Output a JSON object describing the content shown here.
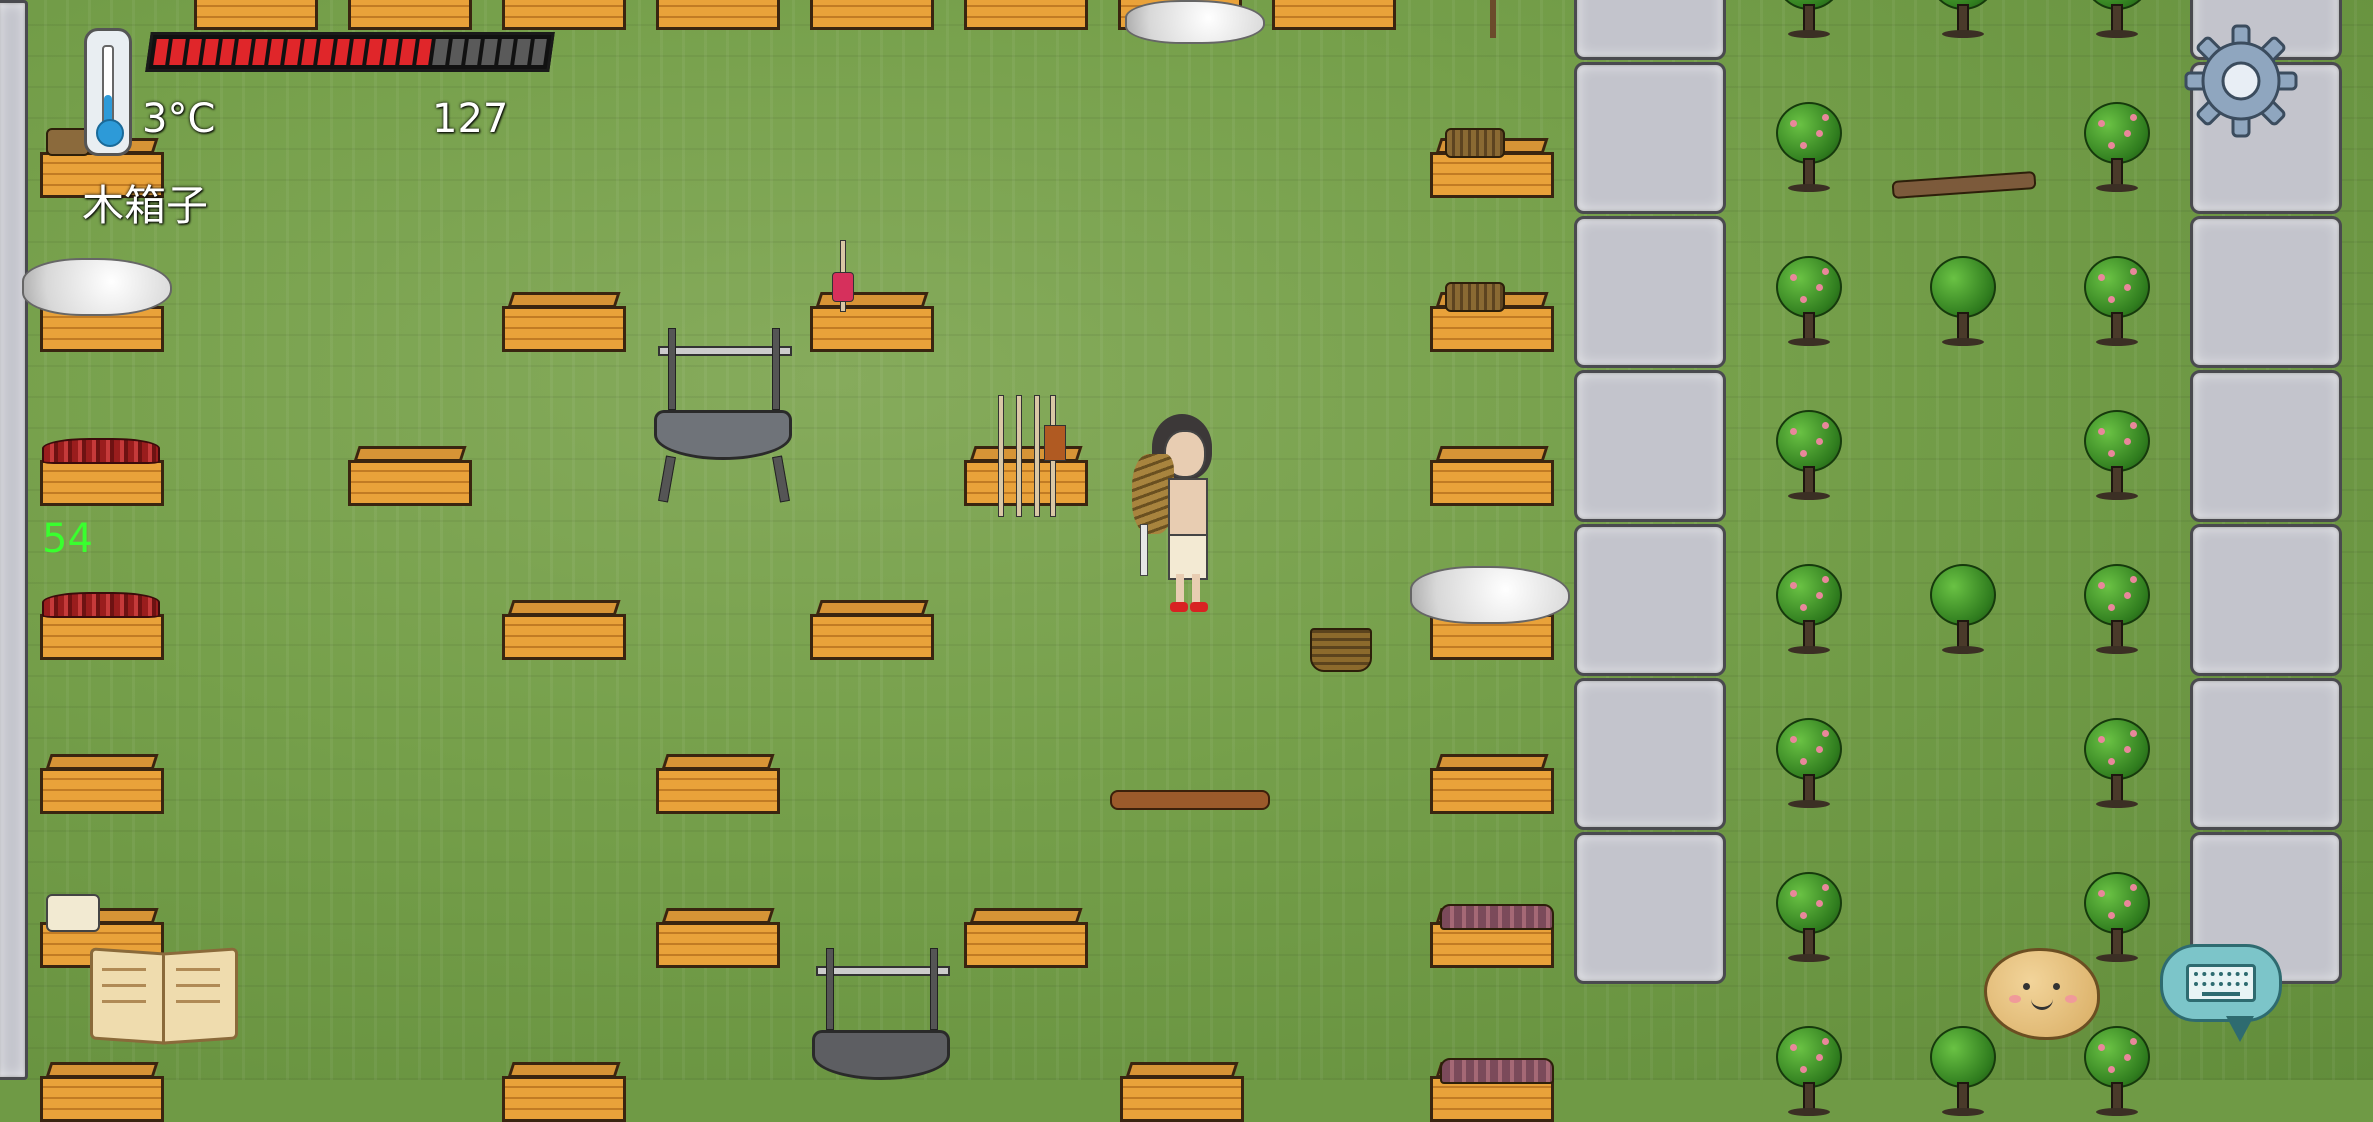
{
  "hud": {
    "temperature": "3°C",
    "counter": "127",
    "hovered_object": "木箱子",
    "age": "54",
    "food_bar": {
      "filled": 17,
      "total": 24
    },
    "colors": {
      "food_fill": "#e0262a",
      "food_empty": "#5a5a5a",
      "age_text": "#39ff2e"
    }
  },
  "icons": {
    "thermometer": "thermometer-icon",
    "settings": "gear-icon",
    "recipe_book": "book-icon",
    "emote": "potato-face-icon",
    "chat": "keyboard-speech-bubble-icon"
  }
}
